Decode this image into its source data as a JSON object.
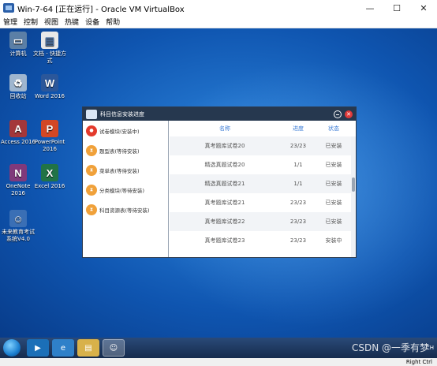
{
  "window": {
    "title": "Win-7-64 [正在运行] - Oracle VM VirtualBox",
    "minimize": "—",
    "maximize": "☐",
    "close": "✕"
  },
  "menu": [
    "管理",
    "控制",
    "视图",
    "热键",
    "设备",
    "帮助"
  ],
  "desktop_icons": [
    {
      "label": "计算机",
      "icon": "computer-icon"
    },
    {
      "label": "文档 - 快捷方式",
      "icon": "document-shortcut-icon"
    },
    {
      "label": "回收站",
      "icon": "recycle-bin-icon"
    },
    {
      "label": "Word 2016",
      "icon": "word-icon"
    },
    {
      "label": "Access 2016",
      "icon": "access-icon"
    },
    {
      "label": "PowerPoint 2016",
      "icon": "powerpoint-icon"
    },
    {
      "label": "OneNote 2016",
      "icon": "onenote-icon"
    },
    {
      "label": "Excel 2016",
      "icon": "excel-icon"
    },
    {
      "label": "未来教育考试系统V4.0",
      "icon": "exam-system-icon"
    }
  ],
  "app": {
    "title": "科目信息安装进度",
    "left_items": [
      {
        "label": "试卷模块(安装中)",
        "state": "active",
        "glyph": "●"
      },
      {
        "label": "题型表(等待安装)",
        "state": "wait",
        "glyph": "⧗"
      },
      {
        "label": "菜单表(等待安装)",
        "state": "wait",
        "glyph": "⧗"
      },
      {
        "label": "分类模块(等待安装)",
        "state": "wait",
        "glyph": "⧗"
      },
      {
        "label": "科目资源表(等待安装)",
        "state": "wait",
        "glyph": "⧗"
      }
    ],
    "columns": [
      "名称",
      "进度",
      "状态"
    ],
    "rows": [
      [
        "真考题库试卷20",
        "23/23",
        "已安装"
      ],
      [
        "精选真题试卷20",
        "1/1",
        "已安装"
      ],
      [
        "精选真题试卷21",
        "1/1",
        "已安装"
      ],
      [
        "真考题库试卷21",
        "23/23",
        "已安装"
      ],
      [
        "真考题库试卷22",
        "23/23",
        "已安装"
      ],
      [
        "真考题库试卷23",
        "23/23",
        "安装中"
      ]
    ]
  },
  "status": {
    "host_key": "Right Ctrl",
    "watermark": "CSDN @一季有梦"
  },
  "tray": {
    "lang": "CH"
  }
}
